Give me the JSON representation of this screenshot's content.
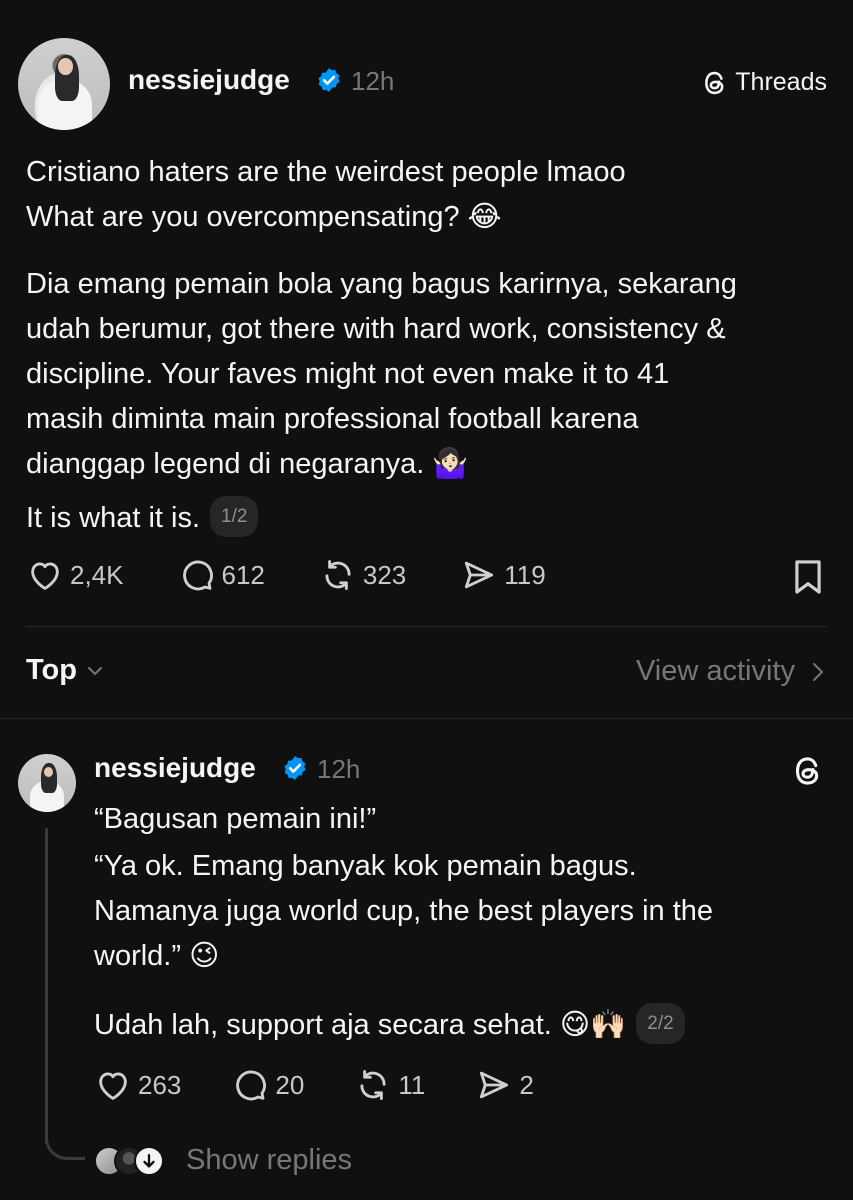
{
  "post": {
    "username": "nessiejudge",
    "time": "12h",
    "brand": "Threads",
    "line1": "Cristiano haters are the weirdest people lmaoo",
    "line2": "What are you overcompensating? 😂",
    "paragraph": "Dia emang pemain bola yang bagus karirnya, sekarang\nudah berumur, got there with hard work, consistency &\ndiscipline. Your faves might not even make it to 41\nmasih diminta main professional football karena\ndianggap legend di negaranya. 🤷🏻‍♀️",
    "closing": "It is what it is.",
    "pager": "1/2",
    "likes": "2,4K",
    "comments": "612",
    "reposts": "323",
    "shares": "119"
  },
  "sort": {
    "label": "Top",
    "view_activity": "View activity"
  },
  "reply": {
    "username": "nessiejudge",
    "time": "12h",
    "line1": "“Bagusan pemain ini!”",
    "paragraph": "“Ya ok. Emang banyak kok pemain bagus.\nNamanya juga world cup, the best players in the\nworld.” 😉",
    "closing": "Udah lah, support aja secara sehat. 😋🙌🏻",
    "pager": "2/2",
    "likes": "263",
    "comments": "20",
    "reposts": "11",
    "shares": "2",
    "show_replies": "Show replies"
  },
  "colors": {
    "background": "#101010",
    "text": "#f3f5f7",
    "muted": "#777777",
    "verified": "#0095f6"
  }
}
